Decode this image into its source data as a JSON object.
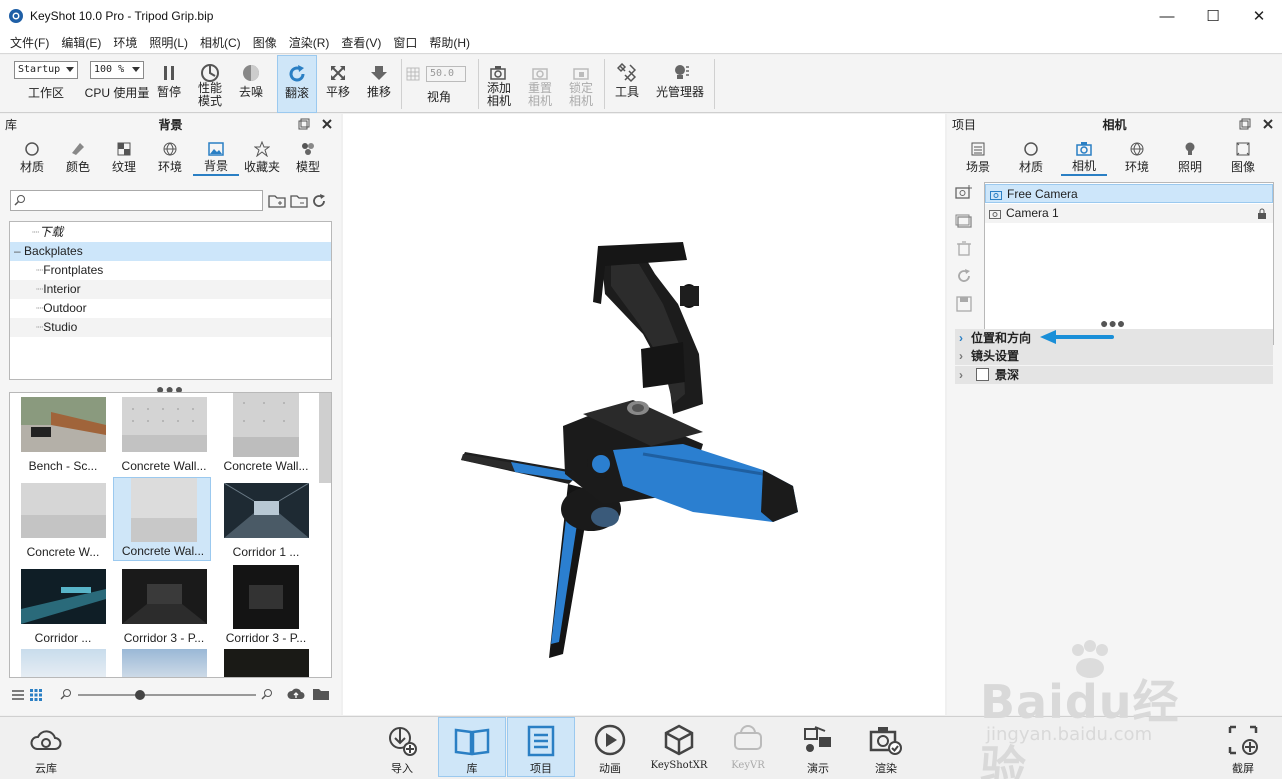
{
  "window": {
    "title": "KeyShot 10.0 Pro  - Tripod Grip.bip",
    "minimize": "—",
    "maximize": "☐",
    "close": "✕"
  },
  "menu": [
    "文件(F)",
    "编辑(E)",
    "环境",
    "照明(L)",
    "相机(C)",
    "图像",
    "渲染(R)",
    "查看(V)",
    "窗口",
    "帮助(H)"
  ],
  "ribbon": {
    "workspace_value": "Startup",
    "workspace_label": "工作区",
    "cpu_value": "100 %",
    "cpu_label": "CPU 使用量",
    "pause": "暂停",
    "performance": "性能\n模式",
    "denoise": "去噪",
    "tumble": "翻滚",
    "pan": "平移",
    "dolly": "推移",
    "fov_value": "50.0",
    "fov_label": "视角",
    "add_camera": "添加\n相机",
    "reset_camera": "重置\n相机",
    "lock_camera": "锁定\n相机",
    "tools": "工具",
    "light_manager": "光管理器"
  },
  "library": {
    "header_left": "库",
    "header_title": "背景",
    "tabs": [
      "材质",
      "颜色",
      "纹理",
      "环境",
      "背景",
      "收藏夹",
      "模型"
    ],
    "active_tab": "背景",
    "search_placeholder": "",
    "tree": [
      "下载",
      "Backplates",
      "Frontplates",
      "Interior",
      "Outdoor",
      "Studio"
    ],
    "thumbs": [
      "Bench - Sc...",
      "Concrete Wall...",
      "Concrete Wall...",
      "Concrete W...",
      "Concrete Wal...",
      "Corridor 1 ...",
      "Corridor ...",
      "Corridor 3 - P...",
      "Corridor 3 - P..."
    ]
  },
  "project": {
    "header_left": "项目",
    "header_title": "相机",
    "tabs": [
      "场景",
      "材质",
      "相机",
      "环境",
      "照明",
      "图像"
    ],
    "active_tab": "相机",
    "cameras": [
      "Free Camera",
      "Camera 1"
    ],
    "sections": [
      "位置和方向",
      "镜头设置",
      "景深"
    ]
  },
  "bottom": {
    "cloud": "云库",
    "import": "导入",
    "library": "库",
    "project": "项目",
    "animation": "动画",
    "keyshotxr": "KeyShotXR",
    "keyvr": "KeyVR",
    "present": "演示",
    "render": "渲染",
    "screenshot": "截屏"
  },
  "watermark": {
    "brand": "Baidu经验",
    "url": "jingyan.baidu.com"
  },
  "colors": {
    "accent": "#2a7fc4",
    "selection": "#cde6fa",
    "grip_blue": "#2b7fd0"
  }
}
